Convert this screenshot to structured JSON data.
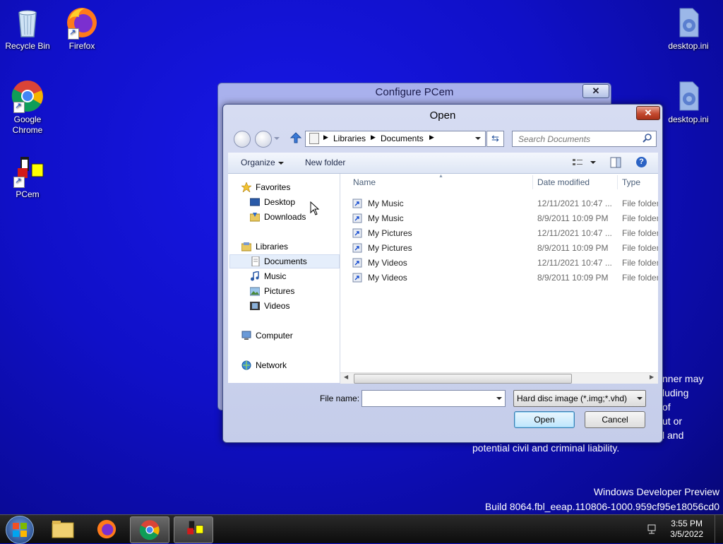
{
  "desktop": {
    "icons": [
      {
        "label": "Recycle Bin"
      },
      {
        "label": "Firefox"
      },
      {
        "label": "Google Chrome"
      },
      {
        "label": "PCem"
      },
      {
        "label": "desktop.ini"
      },
      {
        "label": "desktop.ini"
      }
    ],
    "watermark": {
      "line1": "Windows Developer Preview",
      "line2": "Build 8064.fbl_eeap.110806-1000.959cf95e18056cd0"
    },
    "obscured_text": [
      "nner may",
      "luding",
      "of",
      "ut or",
      "l and",
      "potential civil and criminal liability."
    ]
  },
  "back_dialog": {
    "title": "Configure PCem",
    "close_label": "✕"
  },
  "open_dialog": {
    "title": "Open",
    "close_label": "✕",
    "breadcrumb": [
      "Libraries",
      "Documents"
    ],
    "search_placeholder": "Search Documents",
    "toolbar": {
      "organize": "Organize",
      "new_folder": "New folder"
    },
    "nav": {
      "favorites": "Favorites",
      "desktop": "Desktop",
      "downloads": "Downloads",
      "libraries": "Libraries",
      "documents": "Documents",
      "music": "Music",
      "pictures": "Pictures",
      "videos": "Videos",
      "computer": "Computer",
      "network": "Network"
    },
    "columns": {
      "name": "Name",
      "date": "Date modified",
      "type": "Type"
    },
    "files": [
      {
        "name": "My Music",
        "date": "12/11/2021 10:47 ...",
        "type": "File folder"
      },
      {
        "name": "My Music",
        "date": "8/9/2011 10:09 PM",
        "type": "File folder"
      },
      {
        "name": "My Pictures",
        "date": "12/11/2021 10:47 ...",
        "type": "File folder"
      },
      {
        "name": "My Pictures",
        "date": "8/9/2011 10:09 PM",
        "type": "File folder"
      },
      {
        "name": "My Videos",
        "date": "12/11/2021 10:47 ...",
        "type": "File folder"
      },
      {
        "name": "My Videos",
        "date": "8/9/2011 10:09 PM",
        "type": "File folder"
      }
    ],
    "file_name_label": "File name:",
    "file_name_value": "",
    "file_type": "Hard disc image (*.img;*.vhd)",
    "open_label": "Open",
    "cancel_label": "Cancel"
  },
  "taskbar": {
    "time": "3:55 PM",
    "date": "3/5/2022"
  }
}
